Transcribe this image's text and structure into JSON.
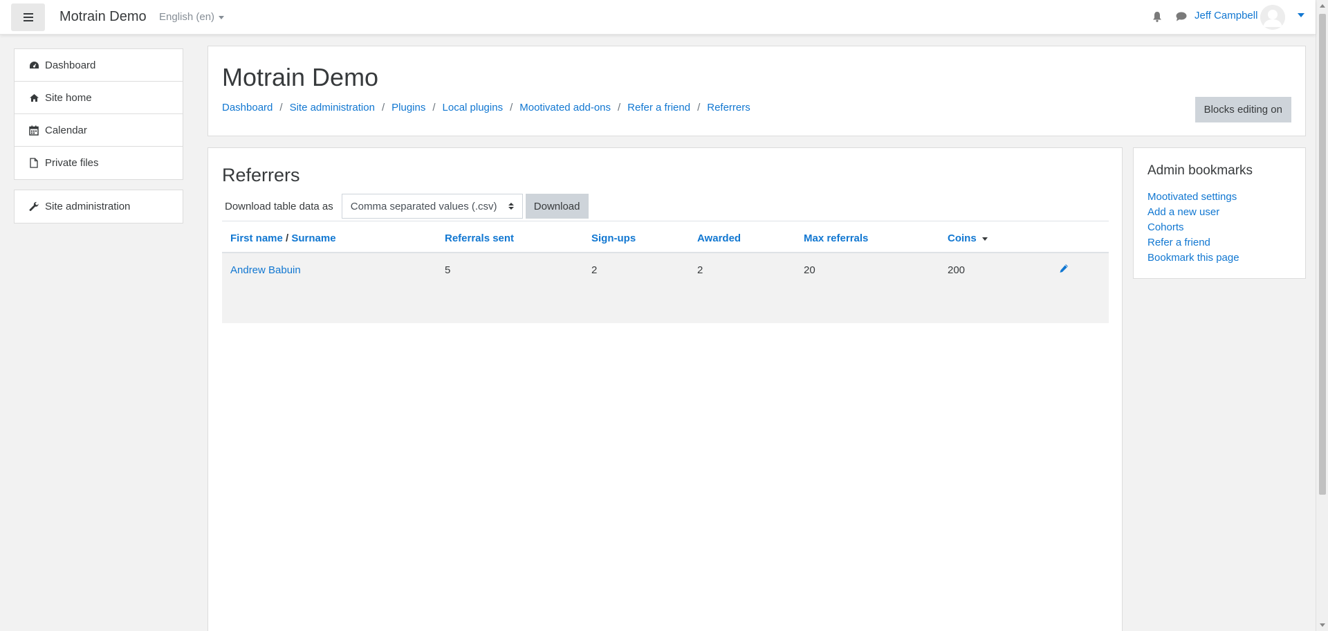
{
  "navbar": {
    "brand": "Motrain Demo",
    "language": "English (en)",
    "user_name": "Jeff Campbell",
    "icons": [
      "hamburger-icon",
      "bell-icon",
      "message-icon",
      "avatar",
      "chevron-down-icon"
    ]
  },
  "drawer": {
    "items": [
      {
        "label": "Dashboard",
        "icon": "dashboard-icon"
      },
      {
        "label": "Site home",
        "icon": "home-icon"
      },
      {
        "label": "Calendar",
        "icon": "calendar-icon"
      },
      {
        "label": "Private files",
        "icon": "file-icon"
      }
    ],
    "admin": {
      "label": "Site administration",
      "icon": "wrench-icon"
    }
  },
  "header": {
    "title": "Motrain Demo",
    "breadcrumb": [
      "Dashboard",
      "Site administration",
      "Plugins",
      "Local plugins",
      "Mootivated add-ons",
      "Refer a friend",
      "Referrers"
    ],
    "blocks_editing_label": "Blocks editing on"
  },
  "main": {
    "heading": "Referrers",
    "download_label": "Download table data as",
    "download_format": "Comma separated values (.csv)",
    "download_button": "Download",
    "table": {
      "columns": {
        "first_name": "First name",
        "name_separator": "/",
        "surname": "Surname",
        "referrals_sent": "Referrals sent",
        "signups": "Sign-ups",
        "awarded": "Awarded",
        "max_referrals": "Max referrals",
        "coins": "Coins"
      },
      "rows": [
        {
          "name": "Andrew Babuin",
          "referrals_sent": "5",
          "signups": "2",
          "awarded": "2",
          "max_referrals": "20",
          "coins": "200"
        }
      ]
    }
  },
  "bookmarks": {
    "title": "Admin bookmarks",
    "links": [
      "Mootivated settings",
      "Add a new user",
      "Cohorts",
      "Refer a friend",
      "Bookmark this page"
    ]
  },
  "colors": {
    "link": "#1177d1",
    "text": "#373a3c",
    "button": "#ced4da",
    "background": "#f2f2f2"
  }
}
